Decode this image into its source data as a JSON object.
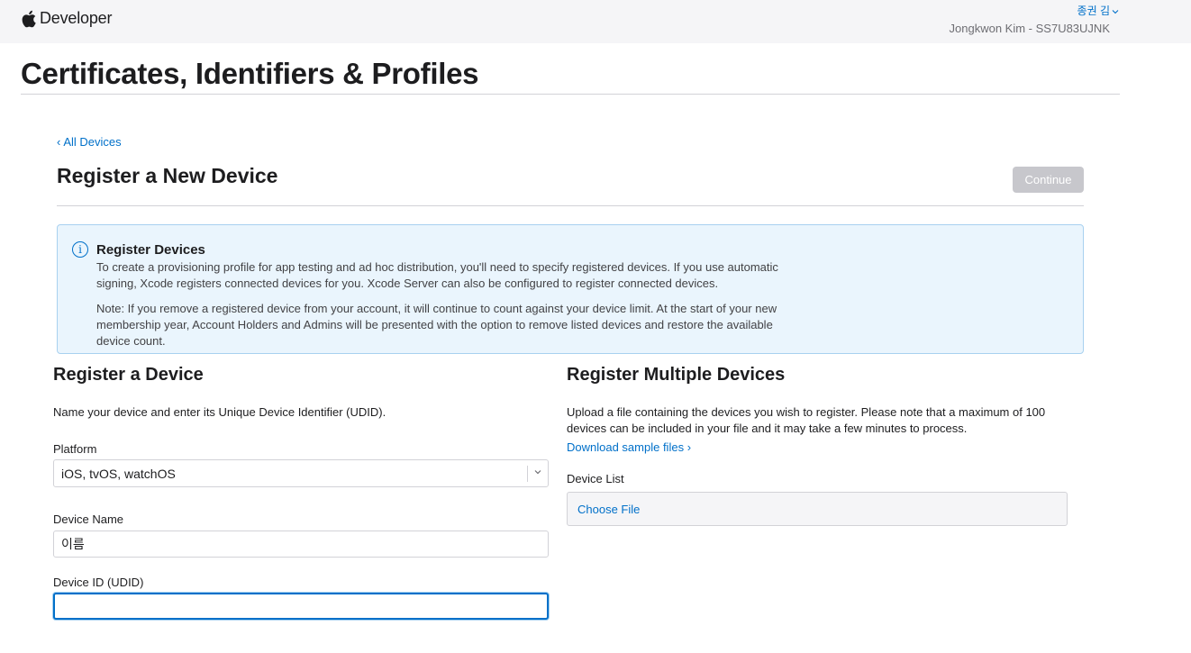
{
  "header": {
    "brand": "Developer",
    "user_name": "종권 김",
    "team": "Jongkwon Kim - SS7U83UJNK"
  },
  "page": {
    "title": "Certificates, Identifiers & Profiles"
  },
  "section": {
    "back_link": "All Devices",
    "title": "Register a New Device",
    "continue_label": "Continue"
  },
  "info": {
    "title": "Register Devices",
    "paragraph1": "To create a provisioning profile for app testing and ad hoc distribution, you'll need to specify registered devices. If you use automatic signing, Xcode registers connected devices for you. Xcode Server can also be configured to register connected devices.",
    "paragraph2": "Note: If you remove a registered device from your account, it will continue to count against your device limit. At the start of your new membership year, Account Holders and Admins will be presented with the option to remove listed devices and restore the available device count."
  },
  "register_device": {
    "title": "Register a Device",
    "description": "Name your device and enter its Unique Device Identifier (UDID).",
    "platform_label": "Platform",
    "platform_value": "iOS, tvOS, watchOS",
    "device_name_label": "Device Name",
    "device_name_value": "이름",
    "device_id_label": "Device ID (UDID)",
    "device_id_value": ""
  },
  "register_multiple": {
    "title": "Register Multiple Devices",
    "description": "Upload a file containing the devices you wish to register. Please note that a maximum of 100 devices can be included in your file and it may take a few minutes to process.",
    "download_link": "Download sample files",
    "device_list_label": "Device List",
    "choose_file_label": "Choose File"
  },
  "colors": {
    "accent": "#0070c9",
    "info_bg": "#eaf5fd",
    "disabled_button": "#c7c7cc"
  }
}
